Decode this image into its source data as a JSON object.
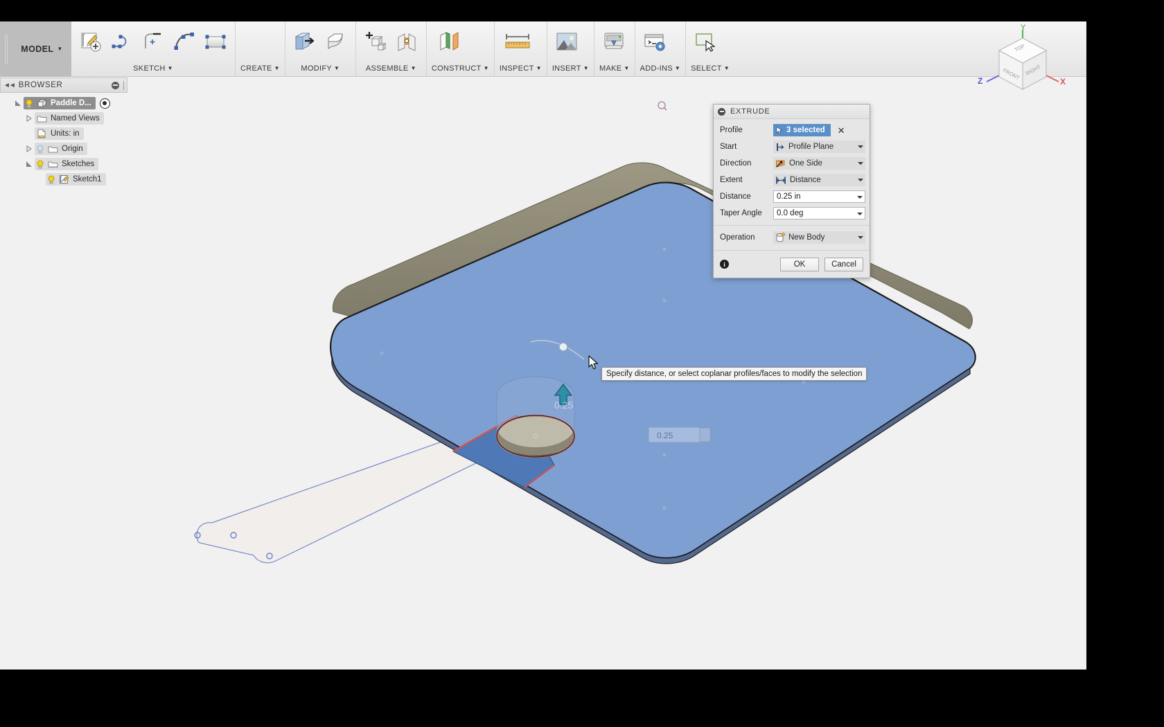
{
  "app": {
    "workspace_label": "MODEL",
    "title": "Fusion 360 Extrude"
  },
  "toolbar": {
    "groups": [
      {
        "name": "sketch",
        "label": "SKETCH",
        "icons": [
          "create-sketch-icon",
          "line-icon",
          "arc-center-icon",
          "arc-icon",
          "rectangle-icon"
        ]
      },
      {
        "name": "create",
        "label": "CREATE",
        "icons": []
      },
      {
        "name": "modify",
        "label": "MODIFY",
        "icons": [
          "extrude-icon",
          "fillet-icon"
        ]
      },
      {
        "name": "assemble",
        "label": "ASSEMBLE",
        "icons": [
          "new-component-icon",
          "joint-icon"
        ]
      },
      {
        "name": "construct",
        "label": "CONSTRUCT",
        "icons": [
          "offset-plane-icon"
        ]
      },
      {
        "name": "inspect",
        "label": "INSPECT",
        "icons": [
          "measure-icon"
        ]
      },
      {
        "name": "insert",
        "label": "INSERT",
        "icons": [
          "insert-image-icon"
        ]
      },
      {
        "name": "make",
        "label": "MAKE",
        "icons": [
          "3d-print-icon"
        ]
      },
      {
        "name": "add-ins",
        "label": "ADD-INS",
        "icons": [
          "scripts-addins-icon"
        ]
      },
      {
        "name": "select",
        "label": "SELECT",
        "icons": [
          "select-window-icon"
        ]
      }
    ]
  },
  "browser": {
    "header": "BROWSER",
    "items": [
      {
        "label": "Paddle D...",
        "depth": 0,
        "icon": "component-icon",
        "twisty": "expanded",
        "bulb": "on",
        "state": "selected",
        "has_eye": true
      },
      {
        "label": "Named Views",
        "depth": 1,
        "icon": "folder-icon",
        "twisty": "collapsed",
        "bulb": "none",
        "state": "highlight",
        "has_eye": false
      },
      {
        "label": "Units: in",
        "depth": 1,
        "icon": "units-icon",
        "twisty": "none",
        "bulb": "none",
        "state": "highlight",
        "has_eye": false
      },
      {
        "label": "Origin",
        "depth": 1,
        "icon": "folder-icon",
        "twisty": "collapsed",
        "bulb": "off",
        "state": "highlight",
        "has_eye": false
      },
      {
        "label": "Sketches",
        "depth": 1,
        "icon": "sketch-folder-icon",
        "twisty": "expanded",
        "bulb": "on",
        "state": "highlight",
        "has_eye": false
      },
      {
        "label": "Sketch1",
        "depth": 2,
        "icon": "sketch-icon",
        "twisty": "none",
        "bulb": "on",
        "state": "highlight",
        "has_eye": false
      }
    ]
  },
  "dialog": {
    "title": "EXTRUDE",
    "minimize_icon": "minimize-icon",
    "rows": [
      {
        "name": "profile",
        "label": "Profile",
        "type": "selection",
        "value": "3 selected",
        "icon": "arrow-select-icon",
        "clear_icon": "clear-selection-icon"
      },
      {
        "name": "start",
        "label": "Start",
        "type": "combo",
        "value": "Profile Plane",
        "icon": "profile-plane-icon"
      },
      {
        "name": "direction",
        "label": "Direction",
        "type": "combo",
        "value": "One Side",
        "icon": "one-side-icon"
      },
      {
        "name": "extent",
        "label": "Extent",
        "type": "combo",
        "value": "Distance",
        "icon": "distance-icon"
      },
      {
        "name": "distance",
        "label": "Distance",
        "type": "text",
        "value": "0.25 in",
        "icon": ""
      },
      {
        "name": "taper-angle",
        "label": "Taper Angle",
        "type": "text",
        "value": "0.0 deg",
        "icon": ""
      },
      {
        "name": "operation",
        "label": "Operation",
        "type": "combo",
        "value": "New Body",
        "icon": "new-body-icon"
      }
    ],
    "info_icon": "info-icon",
    "ok_label": "OK",
    "cancel_label": "Cancel"
  },
  "tooltip": {
    "text": "Specify distance, or select coplanar profiles/faces to modify the selection"
  },
  "canvas": {
    "dimension_label": "0.25",
    "viewcube": {
      "top_label": "TOP",
      "front_label": "FRONT",
      "right_label": "RIGHT",
      "axis_x": "X",
      "axis_y": "Y",
      "axis_z": "Z"
    }
  },
  "colors": {
    "selection_blue": "#5b8fc9",
    "body_face": "#7e9fd1",
    "body_edge_top": "#8a8673",
    "sketch_line": "#6a80c8",
    "highlight_red": "#e8827d",
    "manipulator_arrow": "#2f8fa8",
    "axis_x": "#e06666",
    "axis_y": "#55bb55",
    "axis_z": "#6666dd",
    "toolbar_bg": "#ececec",
    "dialog_bg": "#e6e6e6"
  }
}
